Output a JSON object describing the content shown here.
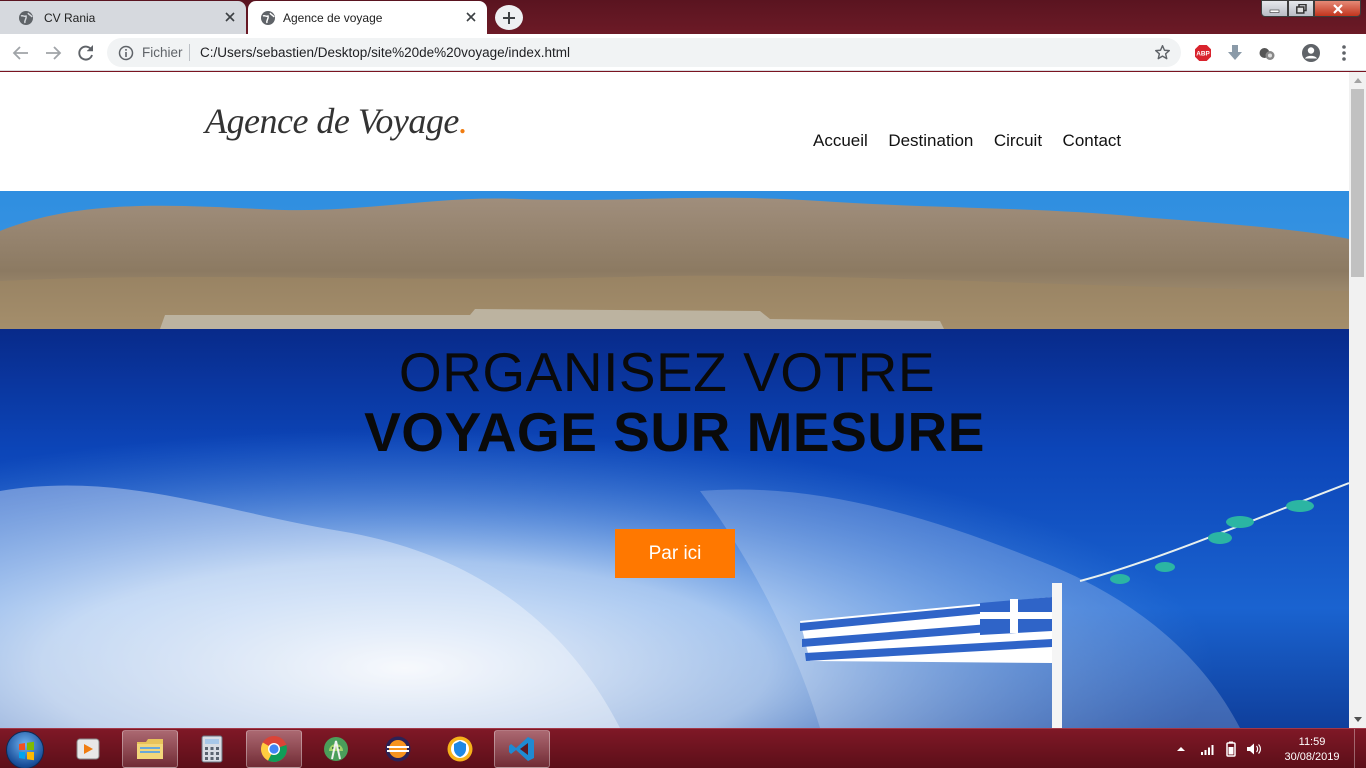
{
  "browser": {
    "tabs": [
      {
        "title": "CV Rania",
        "active": false
      },
      {
        "title": "Agence de voyage",
        "active": true
      }
    ],
    "address_chip": "Fichier",
    "url": "C:/Users/sebastien/Desktop/site%20de%20voyage/index.html",
    "extensions": [
      "adblock-plus-icon",
      "download-icon",
      "extension-icon",
      "profile-icon",
      "menu-icon"
    ],
    "scrollbar_position": 0
  },
  "site": {
    "logo": "Agence de Voyage",
    "logo_dot": ".",
    "nav": [
      "Accueil",
      "Destination",
      "Circuit",
      "Contact"
    ],
    "hero": {
      "line1": "ORGANISEZ VOTRE",
      "line2": "VOYAGE SUR MESURE",
      "button": "Par ici"
    }
  },
  "taskbar": {
    "apps": [
      "start-button",
      "media-player-icon",
      "file-explorer-icon",
      "calculator-icon",
      "chrome-icon",
      "android-studio-icon",
      "eclipse-icon",
      "vpn-icon",
      "vscode-icon"
    ],
    "time": "11:59",
    "date": "30/08/2019"
  },
  "colors": {
    "accent": "#ff7800",
    "taskbar": "#6c1420",
    "tab_active": "#ffffff"
  }
}
